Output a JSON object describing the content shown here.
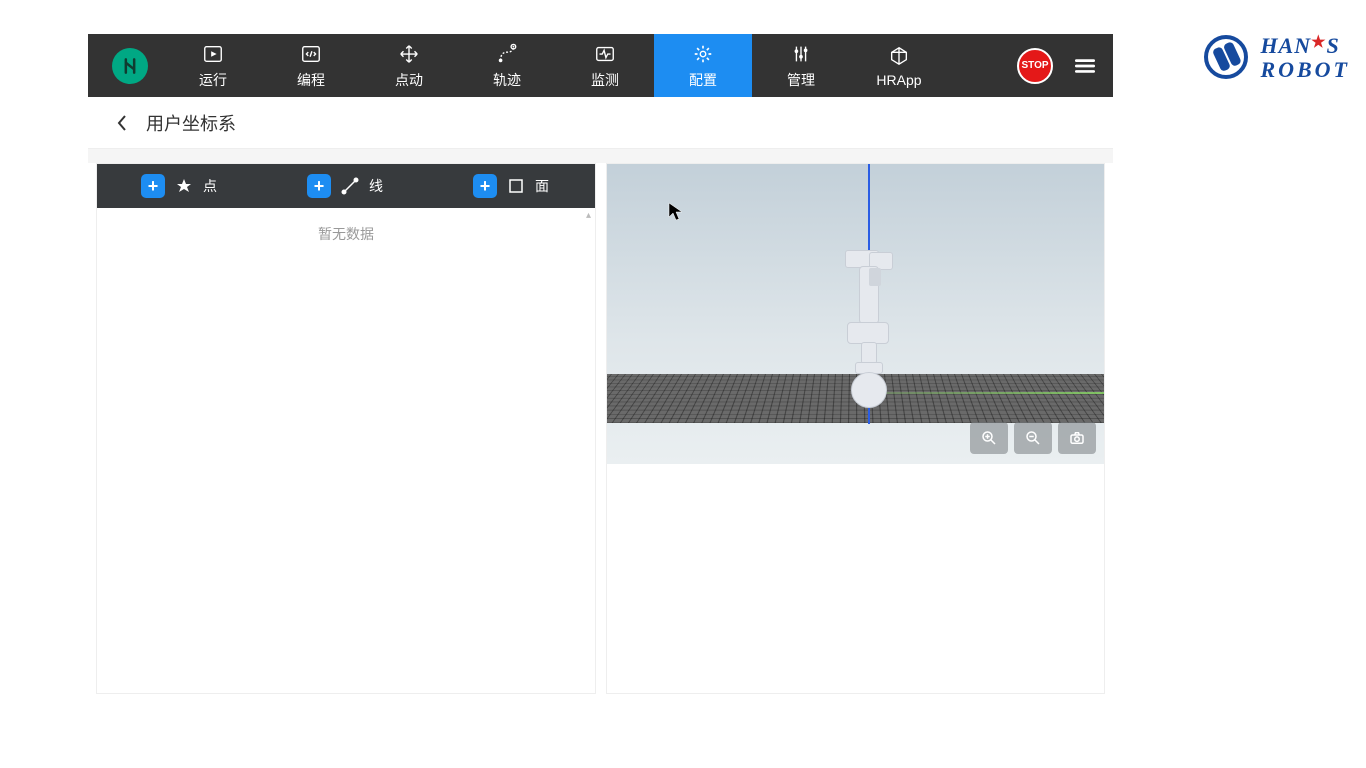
{
  "nav": {
    "items": [
      {
        "label": "运行",
        "icon": "play"
      },
      {
        "label": "编程",
        "icon": "code"
      },
      {
        "label": "点动",
        "icon": "move"
      },
      {
        "label": "轨迹",
        "icon": "path"
      },
      {
        "label": "监测",
        "icon": "monitor"
      },
      {
        "label": "配置",
        "icon": "config",
        "active": true
      },
      {
        "label": "管理",
        "icon": "manage"
      },
      {
        "label": "HRApp",
        "icon": "app"
      }
    ],
    "stop_label": "STOP"
  },
  "subheader": {
    "title": "用户坐标系"
  },
  "add_row": {
    "point_label": "点",
    "line_label": "线",
    "plane_label": "面"
  },
  "list": {
    "empty_text": "暂无数据"
  },
  "watermark": {
    "line1_a": "HAN",
    "line1_b": "S",
    "line2": "ROBOT"
  }
}
